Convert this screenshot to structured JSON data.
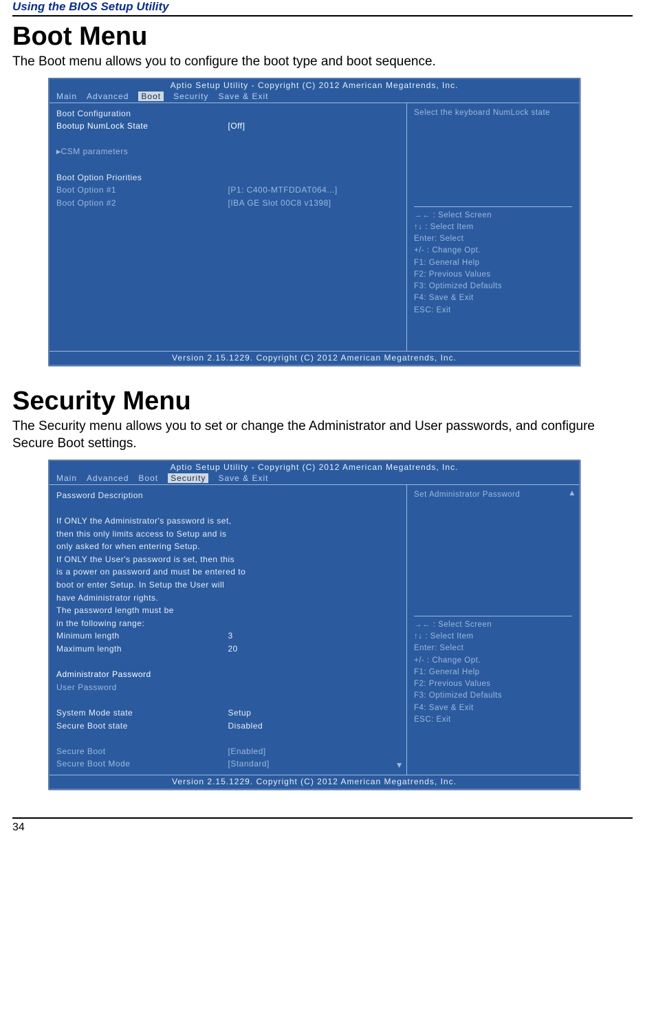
{
  "page": {
    "header": "Using the BIOS Setup Utility",
    "number": "34"
  },
  "sections": [
    {
      "title": "Boot Menu",
      "intro": "The Boot menu allows you to configure the boot type and boot sequence.",
      "bios": {
        "title": "Aptio Setup Utility - Copyright (C) 2012 American Megatrends, Inc.",
        "tabs": [
          "Main",
          "Advanced",
          "Boot",
          "Security",
          "Save & Exit"
        ],
        "active_tab": "Boot",
        "left": {
          "boot_config_heading": "Boot Configuration",
          "numlock_label": "Bootup NumLock State",
          "numlock_value": "[Off]",
          "csm_label": "CSM parameters",
          "priorities_heading": "Boot Option Priorities",
          "opt1_label": "Boot Option #1",
          "opt1_value": "[P1: C400-MTFDDAT064...]",
          "opt2_label": "Boot Option #2",
          "opt2_value": "[IBA GE Slot 00C8 v1398]"
        },
        "right": {
          "help": "Select the keyboard NumLock state",
          "keys": [
            "→← : Select Screen",
            "↑↓ : Select Item",
            "Enter: Select",
            "+/- : Change Opt.",
            "F1: General Help",
            "F2: Previous Values",
            "F3: Optimized Defaults",
            "F4: Save & Exit",
            "ESC: Exit"
          ]
        },
        "footer": "Version 2.15.1229. Copyright (C) 2012 American Megatrends, Inc."
      }
    },
    {
      "title": "Security Menu",
      "intro": "The Security menu allows you to set or change the Administrator and User passwords, and configure Secure Boot settings.",
      "bios": {
        "title": "Aptio Setup Utility - Copyright (C) 2012 American Megatrends, Inc.",
        "tabs": [
          "Main",
          "Advanced",
          "Boot",
          "Security",
          "Save & Exit"
        ],
        "active_tab": "Security",
        "left": {
          "pwd_desc_heading": "Password Description",
          "desc_lines": [
            "If ONLY the Administrator's password is set,",
            "then this only limits access to Setup and is",
            "only asked for when entering Setup.",
            "If ONLY the User's password is set, then this",
            "is a power on password and must be entered to",
            "boot or enter Setup. In Setup the User will",
            "have Administrator rights.",
            "The password length must be",
            "in the following range:"
          ],
          "min_label": "Minimum length",
          "min_value": "3",
          "max_label": "Maximum length",
          "max_value": "20",
          "admin_pwd_label": "Administrator Password",
          "user_pwd_label": "User Password",
          "sysmode_label": "System Mode state",
          "sysmode_value": "Setup",
          "sboot_state_label": "Secure Boot state",
          "sboot_state_value": "Disabled",
          "sboot_label": "Secure Boot",
          "sboot_value": "[Enabled]",
          "sboot_mode_label": "Secure Boot Mode",
          "sboot_mode_value": "[Standard]"
        },
        "right": {
          "help": "Set Administrator Password",
          "keys": [
            "→← : Select Screen",
            "↑↓ : Select Item",
            "Enter: Select",
            "+/- : Change Opt.",
            "F1: General Help",
            "F2: Previous Values",
            "F3: Optimized Defaults",
            "F4: Save & Exit",
            "ESC: Exit"
          ]
        },
        "footer": "Version 2.15.1229. Copyright (C) 2012 American Megatrends, Inc."
      }
    }
  ]
}
